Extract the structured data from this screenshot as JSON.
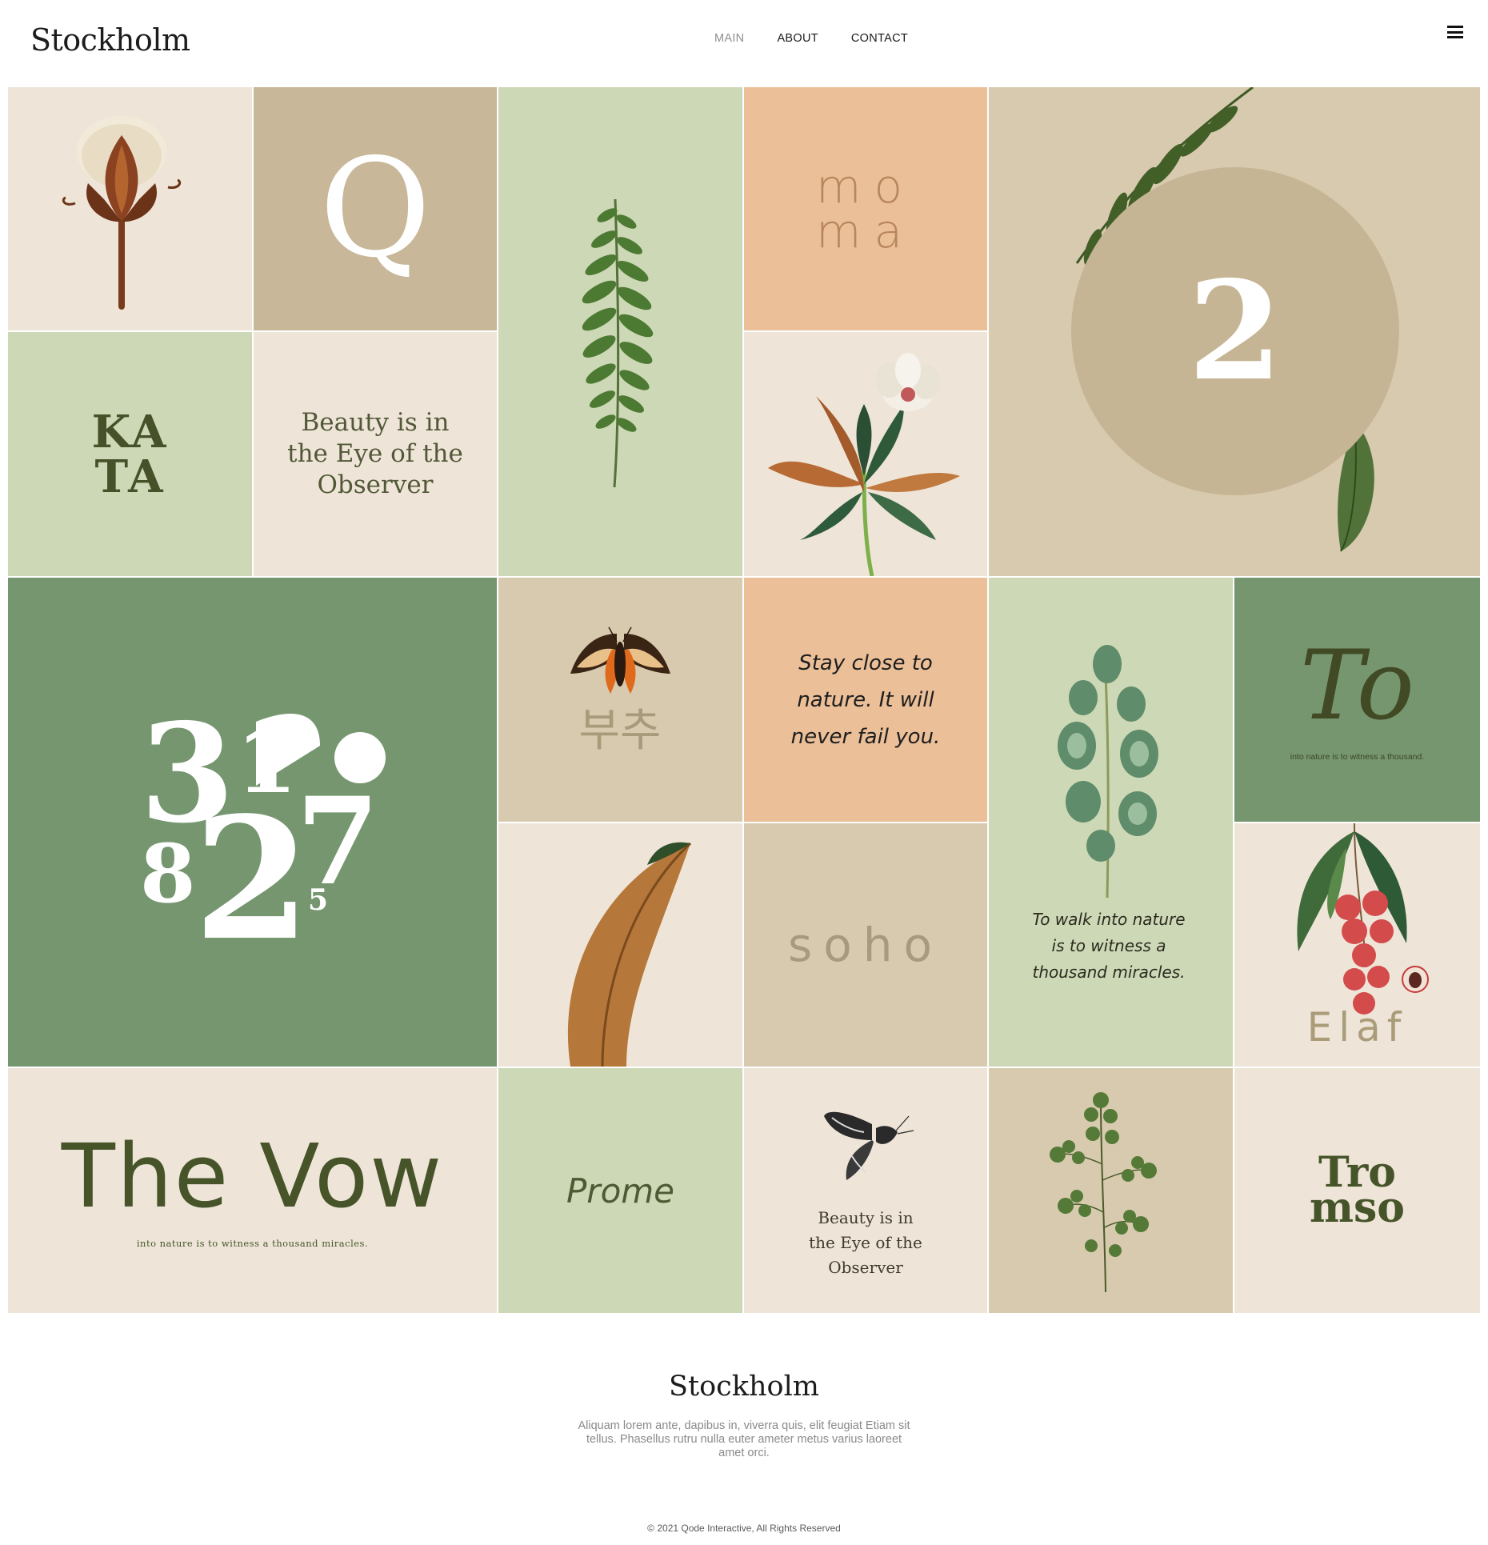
{
  "header": {
    "logo": "Stockholm",
    "nav": [
      {
        "label": "MAIN",
        "active": true
      },
      {
        "label": "ABOUT",
        "active": false
      },
      {
        "label": "CONTACT",
        "active": false
      }
    ],
    "menu_icon": "hamburger-menu-icon"
  },
  "tiles": {
    "cotton": {
      "illustration": "cotton-flower"
    },
    "q": {
      "text": "Q"
    },
    "fern": {
      "illustration": "fern-frond"
    },
    "moma": {
      "line1": "mo",
      "line2": "ma"
    },
    "two": {
      "text": "2",
      "illustration": "fern-and-leaf"
    },
    "kata": {
      "line1": "KA",
      "line2": "TA"
    },
    "beauty": {
      "text": "Beauty is in the Eye of the Observer"
    },
    "magnolia": {
      "illustration": "magnolia-flower"
    },
    "numbers": {
      "glyphs": [
        "3",
        "1",
        "0",
        "8",
        "2",
        "7",
        "5"
      ]
    },
    "moth": {
      "illustration": "moth",
      "korean": "부추"
    },
    "stay": {
      "text": "Stay close to nature. It will never fail you."
    },
    "eucalyptus": {
      "illustration": "eucalyptus-branch",
      "text": "To walk into nature is to witness a thousand miracles."
    },
    "to": {
      "title": "To",
      "subtitle": "into nature is to witness a thousand."
    },
    "leaf": {
      "illustration": "brown-leaf"
    },
    "soho": {
      "text": "soho"
    },
    "lychee": {
      "illustration": "lychee-branch",
      "text": "Elaf"
    },
    "vow": {
      "title": "The Vow",
      "subtitle": "into nature is to witness a thousand miracles."
    },
    "prome": {
      "text": "Prome"
    },
    "butterfly": {
      "illustration": "butterfly",
      "text": "Beauty is in the Eye of the Observer"
    },
    "maidenhair": {
      "illustration": "maidenhair-fern"
    },
    "tromso": {
      "line1": "Tro",
      "line2": "mso"
    }
  },
  "colors": {
    "cream": "#eee5d8",
    "tan": "#c8b798",
    "sand": "#d8caae",
    "sage": "#cdd8b6",
    "green": "#769670",
    "peach": "#ebbf98",
    "olive_text": "#46512a"
  },
  "footer": {
    "title": "Stockholm",
    "text": "Aliquam lorem ante, dapibus in, viverra quis, elit feugiat Etiam sit tellus. Phasellus rutru nulla euter ameter metus varius laoreet amet orci.",
    "copyright": "© 2021 Qode Interactive, All Rights Reserved"
  }
}
